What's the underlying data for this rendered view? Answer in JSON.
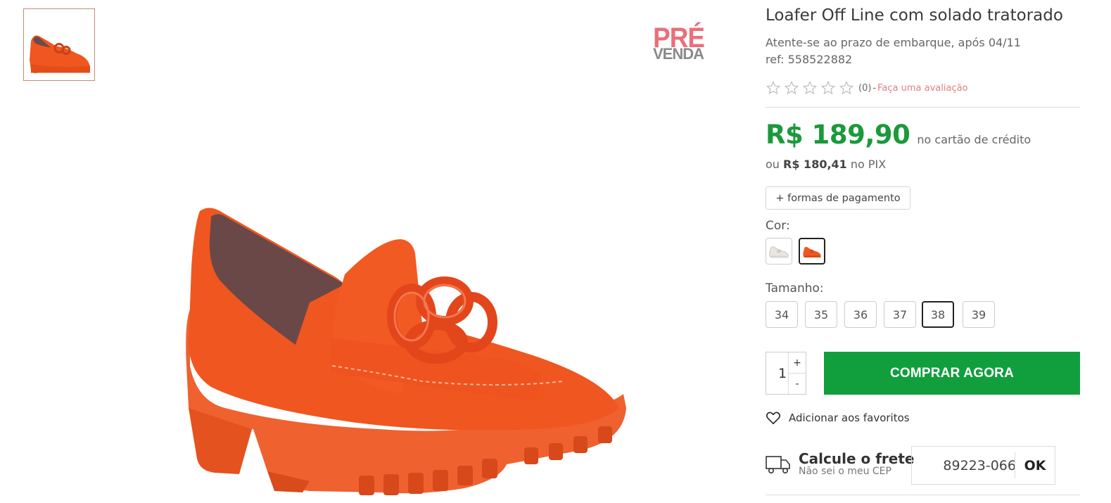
{
  "gallery": {
    "thumbnails": [
      {
        "icon": "orange-loafer-thumbnail"
      }
    ]
  },
  "badge": {
    "line1": "PRÉ",
    "line2": "VENDA"
  },
  "product": {
    "title": "Loafer Off Line com solado tratorado",
    "notice": "Atente-se ao prazo de embarque, após 04/11",
    "ref": "ref: 558522882",
    "rating": {
      "stars": 0,
      "max": 5,
      "count": "(0)",
      "sep": "-",
      "link": "Faça uma avaliação"
    },
    "price": {
      "amount": "R$ 189,90",
      "note": "no cartão de crédito"
    },
    "pix": {
      "prefix": "ou",
      "amount": "R$ 180,41",
      "suffix": "no PIX"
    },
    "payment_button": "+ formas de pagamento",
    "color_label": "Cor:",
    "colors": [
      {
        "name": "branco",
        "selected": false
      },
      {
        "name": "laranja",
        "selected": true
      }
    ],
    "size_label": "Tamanho:",
    "sizes": [
      {
        "label": "34",
        "selected": false
      },
      {
        "label": "35",
        "selected": false
      },
      {
        "label": "36",
        "selected": false
      },
      {
        "label": "37",
        "selected": false
      },
      {
        "label": "38",
        "selected": true
      },
      {
        "label": "39",
        "selected": false
      }
    ],
    "quantity": "1",
    "qty_plus": "+",
    "qty_minus": "-",
    "buy_button": "COMPRAR AGORA",
    "favorites": "Adicionar aos favoritos",
    "shipping": {
      "title": "Calcule o frete",
      "subtitle": "Não sei o meu CEP",
      "cep_value": "89223-066",
      "ok": "OK"
    }
  },
  "colors": {
    "price_green": "#1a9a3a",
    "buy_green": "#109f3c",
    "accent_pink": "#e08080",
    "shoe_orange": "#f0561f"
  }
}
